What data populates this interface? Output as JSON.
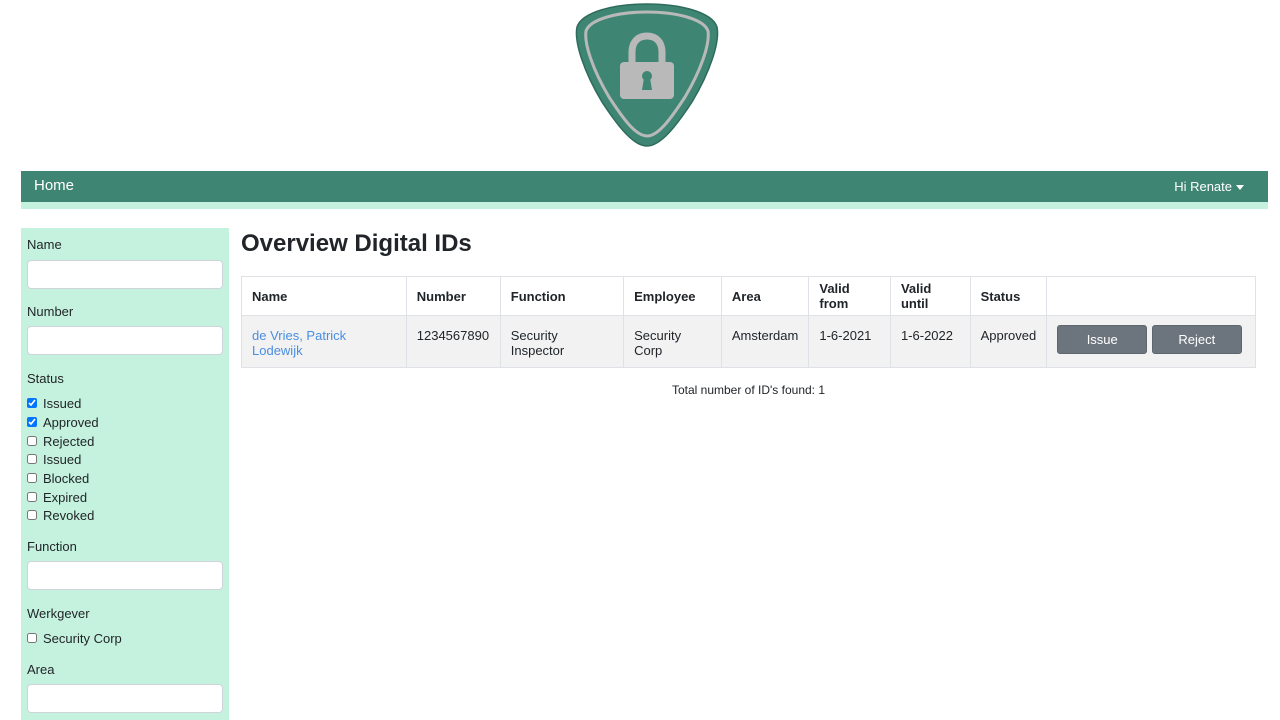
{
  "header": {
    "logo_icon": "lock-icon",
    "brand_color": "#3e8673",
    "accent_color": "#c5f2de"
  },
  "navbar": {
    "home_label": "Home",
    "user_label": "Hi Renate"
  },
  "sidebar": {
    "name_label": "Name",
    "name_value": "",
    "number_label": "Number",
    "number_value": "",
    "status_label": "Status",
    "status_options": [
      {
        "label": "Issued",
        "checked": true
      },
      {
        "label": "Approved",
        "checked": true
      },
      {
        "label": "Rejected",
        "checked": false
      },
      {
        "label": "Issued",
        "checked": false
      },
      {
        "label": "Blocked",
        "checked": false
      },
      {
        "label": "Expired",
        "checked": false
      },
      {
        "label": "Revoked",
        "checked": false
      }
    ],
    "function_label": "Function",
    "function_value": "",
    "werkgever_label": "Werkgever",
    "werkgever_options": [
      {
        "label": "Security Corp",
        "checked": false
      }
    ],
    "area_label": "Area",
    "area_value": ""
  },
  "main": {
    "title": "Overview Digital IDs",
    "table": {
      "headers": [
        "Name",
        "Number",
        "Function",
        "Employee",
        "Area",
        "Valid from",
        "Valid until",
        "Status",
        ""
      ],
      "rows": [
        {
          "name": "de Vries, Patrick Lodewijk",
          "number": "1234567890",
          "function": "Security Inspector",
          "employee": "Security Corp",
          "area": "Amsterdam",
          "valid_from": "1-6-2021",
          "valid_until": "1-6-2022",
          "status": "Approved",
          "issue_label": "Issue",
          "reject_label": "Reject"
        }
      ]
    },
    "total_text": "Total number of ID's found: 1"
  }
}
